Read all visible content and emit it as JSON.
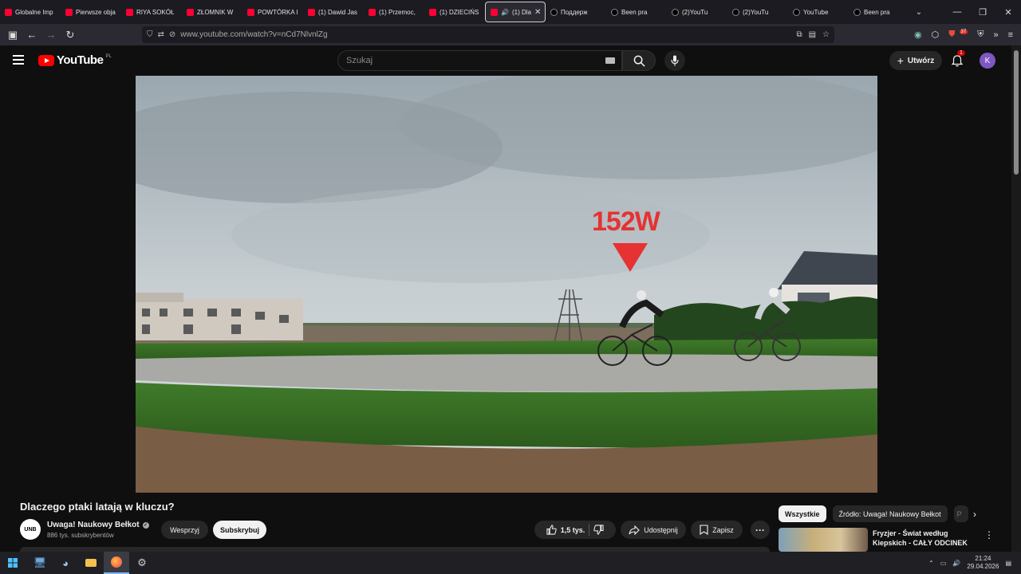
{
  "browser": {
    "tabs": [
      {
        "label": "Globalne Imp",
        "favicon": "youtube-icon"
      },
      {
        "label": "Pierwsze obja",
        "favicon": "youtube-icon"
      },
      {
        "label": "RIYA SOKÓŁ",
        "favicon": "youtube-icon"
      },
      {
        "label": "ZŁOMNIK W",
        "favicon": "youtube-icon"
      },
      {
        "label": "POWTÓRKA I",
        "favicon": "youtube-icon"
      },
      {
        "label": "(1) Dawid Jas",
        "favicon": "youtube-icon"
      },
      {
        "label": "(1) Przemoc,",
        "favicon": "youtube-icon"
      },
      {
        "label": "(1) DZIECIŃS",
        "favicon": "youtube-icon"
      },
      {
        "label": "(1) Dla",
        "favicon": "youtube-icon",
        "active": true
      },
      {
        "label": "Поддерж",
        "favicon": "tiktok-icon"
      },
      {
        "label": "Been pra",
        "favicon": "tiktok-icon"
      },
      {
        "label": "(2)YouTu",
        "favicon": "tiktok-icon"
      },
      {
        "label": "(2)YouTu",
        "favicon": "tiktok-icon"
      },
      {
        "label": "YouTube",
        "favicon": "tiktok-icon"
      },
      {
        "label": "Been pra",
        "favicon": "tiktok-icon"
      }
    ],
    "url": "www.youtube.com/watch?v=nCd7NlvnlZg",
    "extension_badge": "37"
  },
  "youtube": {
    "logo_text": "YouTube",
    "country_code": "PL",
    "search_placeholder": "Szukaj",
    "create_label": "Utwórz",
    "notification_count": "1",
    "avatar_letter": "K"
  },
  "video": {
    "overlay_text": "152W",
    "title": "Dlaczego ptaki latają w kluczu?"
  },
  "channel": {
    "logo_text": "UNB",
    "name": "Uwaga! Naukowy Bełkot",
    "subscribers": "886 tys. subskrybentów",
    "support_label": "Wesprzyj",
    "subscribe_label": "Subskrybuj"
  },
  "actions": {
    "likes": "1,5 tys.",
    "share_label": "Udostępnij",
    "save_label": "Zapisz"
  },
  "sidebar": {
    "chips": [
      "Wszystkie",
      "Źródło: Uwaga! Naukowy Bełkot",
      "P"
    ],
    "recommendation_title": "Fryzjer - Świat według Kiepskich - CAŁY ODCINEK ..."
  },
  "taskbar": {
    "time": "21:24",
    "date": "29.04.2026"
  }
}
